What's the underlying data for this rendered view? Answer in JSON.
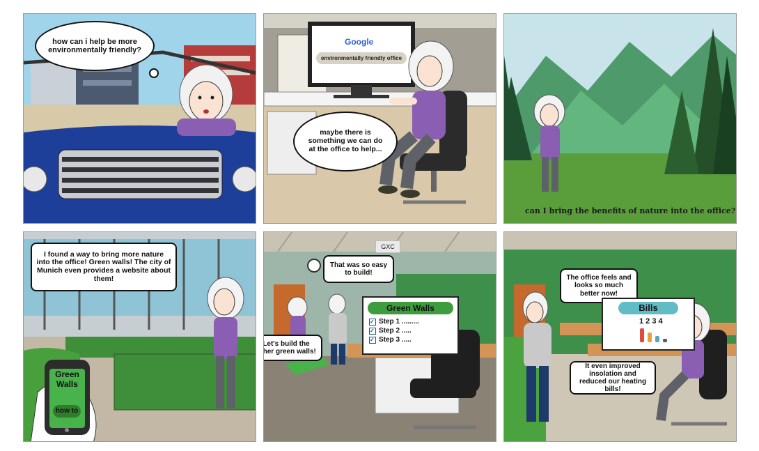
{
  "panels": [
    {
      "bubble": "how can i help be more environmentally friendly?"
    },
    {
      "google_logo": "Google",
      "search_text": "environmentally friendly office",
      "bubble": "maybe there is something we can do at the office to help..."
    },
    {
      "caption": "can I bring the benefits of nature into the office?"
    },
    {
      "bubble": "I found a way to bring more nature into the office! Green walls! The city of Munich even provides a website about them!",
      "phone_title": "Green Walls",
      "phone_button": "how to"
    },
    {
      "tag": "GXC",
      "bubble_top": "That was so easy to build!",
      "bubble_bottom": "Let's build the other green walls!",
      "board_title": "Green Walls",
      "steps": [
        "Step 1 .........",
        "Step 2 .....",
        "Step 3 ....."
      ]
    },
    {
      "bubble_top": "The office feels and looks so much better now!",
      "board_title": "Bills",
      "board_numbers": "1 2 3 4",
      "bubble_bottom": "It even improved insolation and reduced our heating bills!"
    }
  ],
  "colors": {
    "purple": "#8a5fb3",
    "green": "#3f8f3a",
    "blue_car": "#1d3f99"
  }
}
